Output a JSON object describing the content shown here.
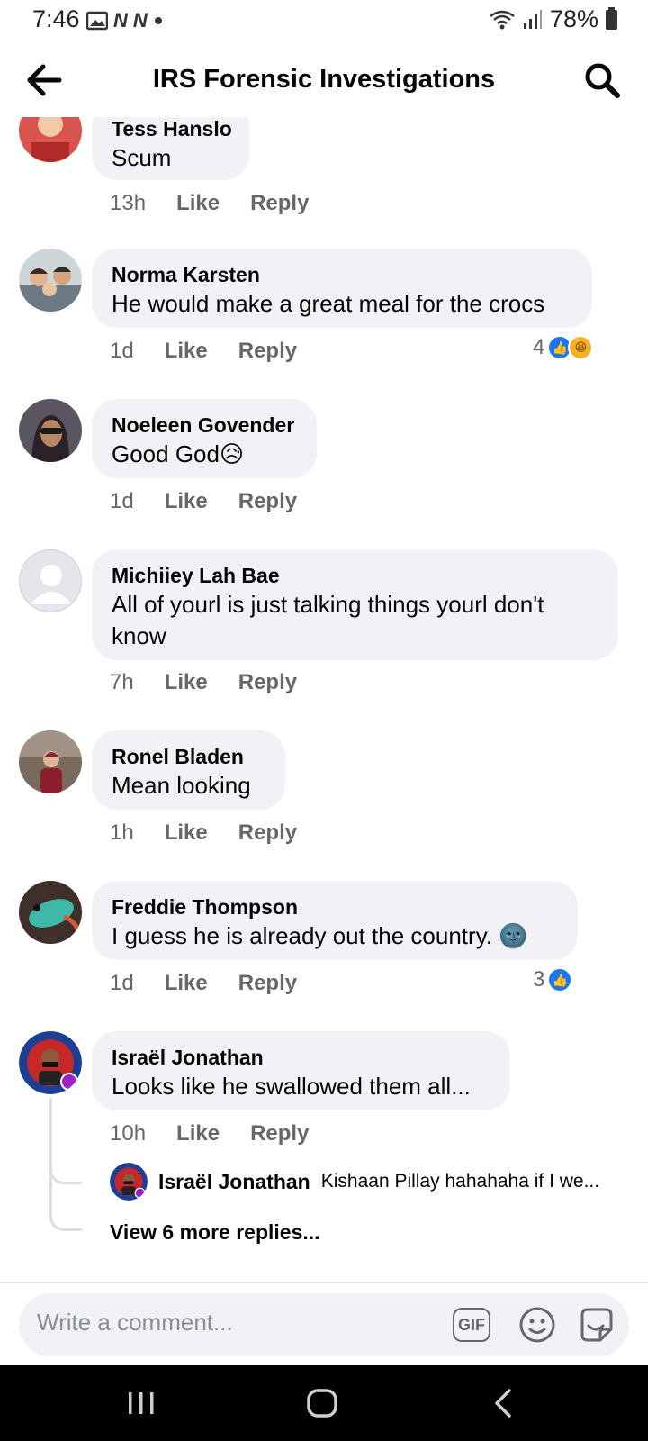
{
  "status_bar": {
    "time": "7:46",
    "battery": "78%"
  },
  "header": {
    "title": "IRS Forensic Investigations"
  },
  "comments": [
    {
      "author": "Tess Hanslo",
      "text": "Scum",
      "time": "13h",
      "like": "Like",
      "reply": "Reply"
    },
    {
      "author": "Norma Karsten",
      "text": "He would make a great meal for the crocs",
      "time": "1d",
      "like": "Like",
      "reply": "Reply",
      "reaction_count": "4"
    },
    {
      "author": "Noeleen Govender",
      "text": "Good God😥",
      "time": "1d",
      "like": "Like",
      "reply": "Reply"
    },
    {
      "author": "Michiiey Lah Bae",
      "text": "All of yourl is just talking things yourl don't know",
      "time": "7h",
      "like": "Like",
      "reply": "Reply"
    },
    {
      "author": "Ronel Bladen",
      "text": "Mean looking",
      "time": "1h",
      "like": "Like",
      "reply": "Reply"
    },
    {
      "author": "Freddie Thompson",
      "text": "I guess he is already out the country. 🌚",
      "time": "1d",
      "like": "Like",
      "reply": "Reply",
      "reaction_count": "3"
    },
    {
      "author": "Israël Jonathan",
      "text": "Looks like he swallowed them all...",
      "time": "10h",
      "like": "Like",
      "reply": "Reply"
    }
  ],
  "reply_preview": {
    "author": "Israël Jonathan",
    "text": "Kishaan Pillay hahahaha if I we..."
  },
  "view_more": "View 6 more replies...",
  "composer": {
    "placeholder": "Write a comment...",
    "gif_label": "GIF"
  },
  "colors": {
    "bubble": "#f0f2f5",
    "secondary_text": "#65676b",
    "like_blue": "#1877f2"
  }
}
